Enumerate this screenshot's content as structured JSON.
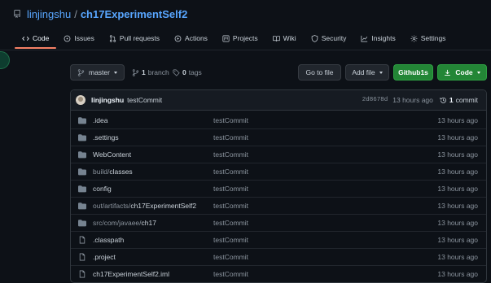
{
  "repo": {
    "owner": "linjingshu",
    "separator": "/",
    "name": "ch17ExperimentSelf2"
  },
  "tabs": [
    {
      "label": "Code",
      "icon": "code-icon"
    },
    {
      "label": "Issues",
      "icon": "issue-icon"
    },
    {
      "label": "Pull requests",
      "icon": "pull-request-icon"
    },
    {
      "label": "Actions",
      "icon": "play-icon"
    },
    {
      "label": "Projects",
      "icon": "project-icon"
    },
    {
      "label": "Wiki",
      "icon": "book-icon"
    },
    {
      "label": "Security",
      "icon": "shield-icon"
    },
    {
      "label": "Insights",
      "icon": "graph-icon"
    },
    {
      "label": "Settings",
      "icon": "gear-icon"
    }
  ],
  "toolbar": {
    "branch_selector": "master",
    "branch_count": "1",
    "branch_label": "branch",
    "tag_count": "0",
    "tag_label": "tags",
    "go_to_file": "Go to file",
    "add_file": "Add file",
    "github1s": "Github1s",
    "code": "Code"
  },
  "latest_commit": {
    "author": "linjingshu",
    "message": "testCommit",
    "sha": "2d8678d",
    "time": "13 hours ago",
    "count": "1",
    "count_label": "commit"
  },
  "files": [
    {
      "type": "dir",
      "prefix": "",
      "name": ".idea",
      "message": "testCommit",
      "time": "13 hours ago"
    },
    {
      "type": "dir",
      "prefix": "",
      "name": ".settings",
      "message": "testCommit",
      "time": "13 hours ago"
    },
    {
      "type": "dir",
      "prefix": "",
      "name": "WebContent",
      "message": "testCommit",
      "time": "13 hours ago"
    },
    {
      "type": "dir",
      "prefix": "build/",
      "name": "classes",
      "message": "testCommit",
      "time": "13 hours ago"
    },
    {
      "type": "dir",
      "prefix": "",
      "name": "config",
      "message": "testCommit",
      "time": "13 hours ago"
    },
    {
      "type": "dir",
      "prefix": "out/artifacts/",
      "name": "ch17ExperimentSelf2",
      "message": "testCommit",
      "time": "13 hours ago"
    },
    {
      "type": "dir",
      "prefix": "src/com/javaee/",
      "name": "ch17",
      "message": "testCommit",
      "time": "13 hours ago"
    },
    {
      "type": "file",
      "prefix": "",
      "name": ".classpath",
      "message": "testCommit",
      "time": "13 hours ago"
    },
    {
      "type": "file",
      "prefix": "",
      "name": ".project",
      "message": "testCommit",
      "time": "13 hours ago"
    },
    {
      "type": "file",
      "prefix": "",
      "name": "ch17ExperimentSelf2.iml",
      "message": "testCommit",
      "time": "13 hours ago"
    }
  ],
  "colors": {
    "background": "#0d1117",
    "link": "#58a6ff",
    "accent_tab": "#f78166",
    "green_button": "#238636",
    "folder_icon": "#768390"
  }
}
